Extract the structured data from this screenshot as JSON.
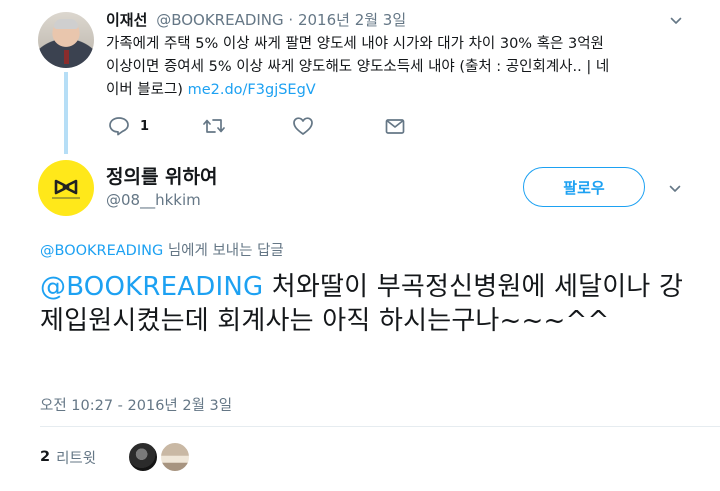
{
  "parent_tweet": {
    "name": "이재선",
    "meta": "@BOOKREADING · 2016년 2월 3일",
    "text_lines": [
      "가족에게 주택 5% 이상 싸게 팔면 양도세 내야 시가와 대가 차이 30% 혹은 3억원",
      "이상이면 증여세 5% 이상 싸게 양도해도 양도소득세 내야 (출처 : 공인회계사.. | 네"
    ],
    "text_line3_prefix": "이버 블로그) ",
    "link": "me2.do/F3gjSEgV",
    "reply_count": "1"
  },
  "main_tweet": {
    "name": "정의를 위하여",
    "handle": "@08__hkkim",
    "follow_label": "팔로우",
    "replying_to_handle": "@BOOKREADING",
    "replying_to_suffix": " 님에게 보내는 답글",
    "mention": "@BOOKREADING",
    "text_rest": " 처와딸이 부곡정신병원에 세달이나 강제입원시켰는데 회계사는  아직 하시는구나~~~^^",
    "timestamp": "오전 10:27 - 2016년 2월 3일",
    "retweet_count": "2",
    "retweet_label": "리트윗"
  },
  "colors": {
    "link": "#1da1f2",
    "secondary": "#657786",
    "thread_line": "#b6def6",
    "avatar_yellow": "#ffe81a"
  },
  "icons": [
    "caret-down-icon",
    "reply-icon",
    "retweet-icon",
    "like-icon",
    "message-icon"
  ]
}
